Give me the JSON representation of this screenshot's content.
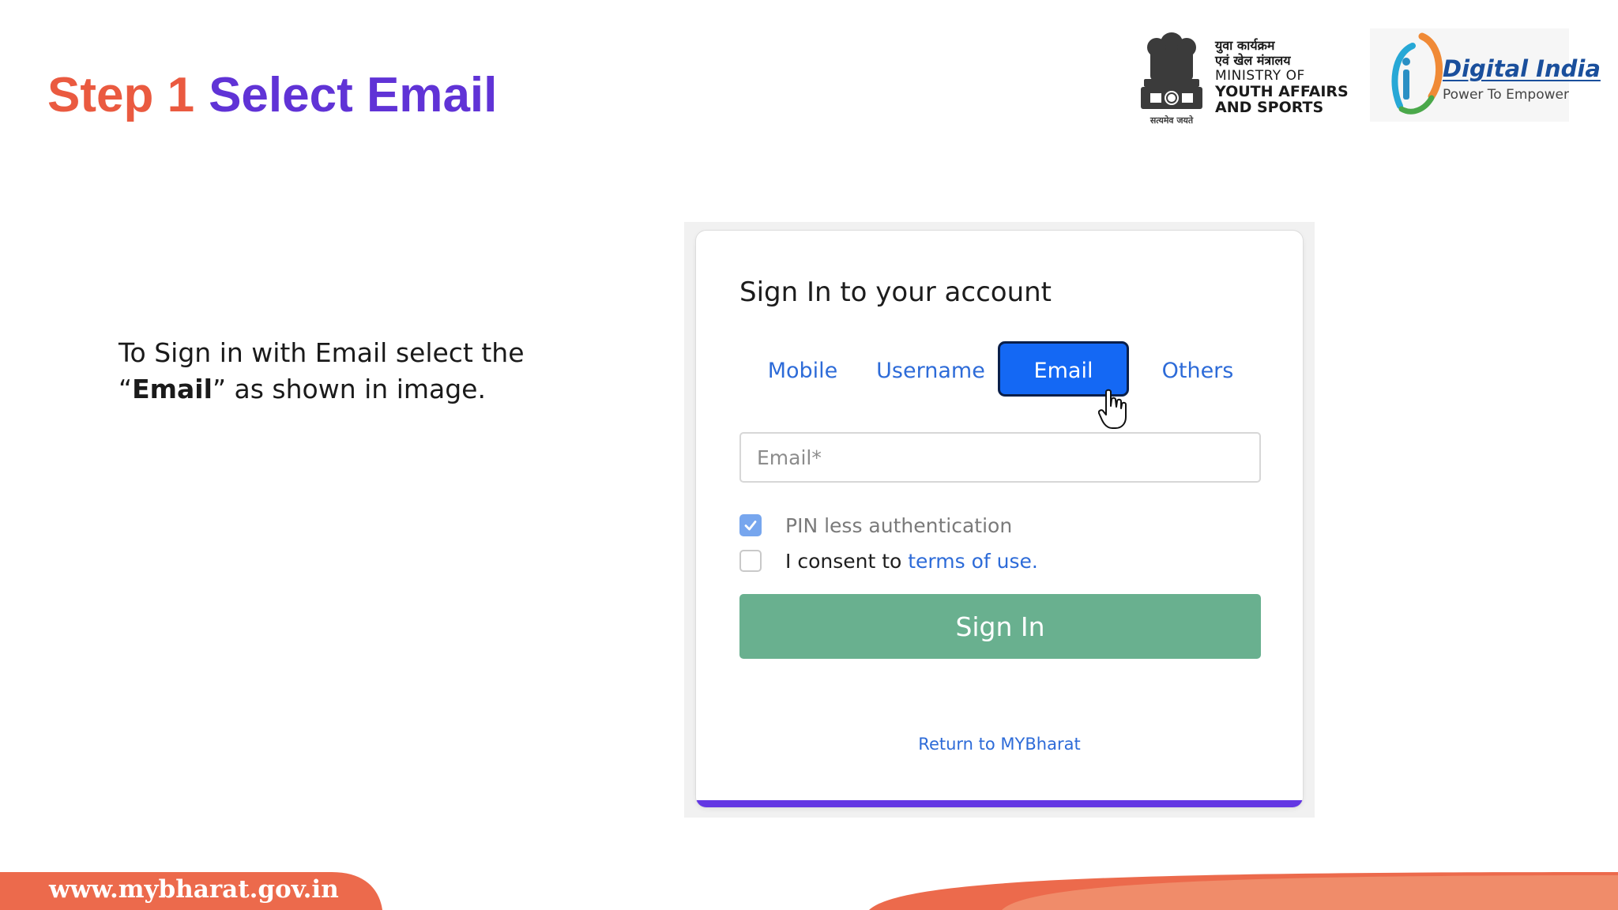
{
  "slide": {
    "step_label": "Step 1",
    "step_action": "Select Email",
    "instruction": {
      "line1": "To Sign in with Email select the",
      "open_quote": "“",
      "bold_word": "Email",
      "line2_rest": "” as shown in image."
    }
  },
  "logos": {
    "emblem_motto": "सत्यमेव जयते",
    "ministry_hindi_1": "युवा कार्यक्रम",
    "ministry_hindi_2": "एवं खेल मंत्रालय",
    "ministry_en_1": "MINISTRY OF",
    "ministry_en_2": "YOUTH AFFAIRS",
    "ministry_en_3": "AND SPORTS",
    "digital_india_title": "Digital India",
    "digital_india_tagline": "Power To Empower"
  },
  "login": {
    "title": "Sign In to your account",
    "tabs": [
      {
        "label": "Mobile",
        "active": false
      },
      {
        "label": "Username",
        "active": false
      },
      {
        "label": "Email",
        "active": true
      },
      {
        "label": "Others",
        "active": false
      }
    ],
    "email_placeholder": "Email*",
    "email_value": "",
    "pin_less": {
      "label": "PIN less authentication",
      "checked": true
    },
    "consent": {
      "prefix": "I consent to ",
      "link": "terms of use.",
      "checked": false
    },
    "signin_label": "Sign In",
    "return_label": "Return to MYBharat"
  },
  "footer": {
    "url": "www.mybharat.gov.in"
  },
  "colors": {
    "step": "#ea5a40",
    "action": "#6033d6",
    "tab_active_bg": "#1468f4",
    "link": "#2d6bd8",
    "signin_bg": "#69b08f",
    "card_accent": "#6337e3",
    "footer_orange": "#ec6a4c"
  }
}
